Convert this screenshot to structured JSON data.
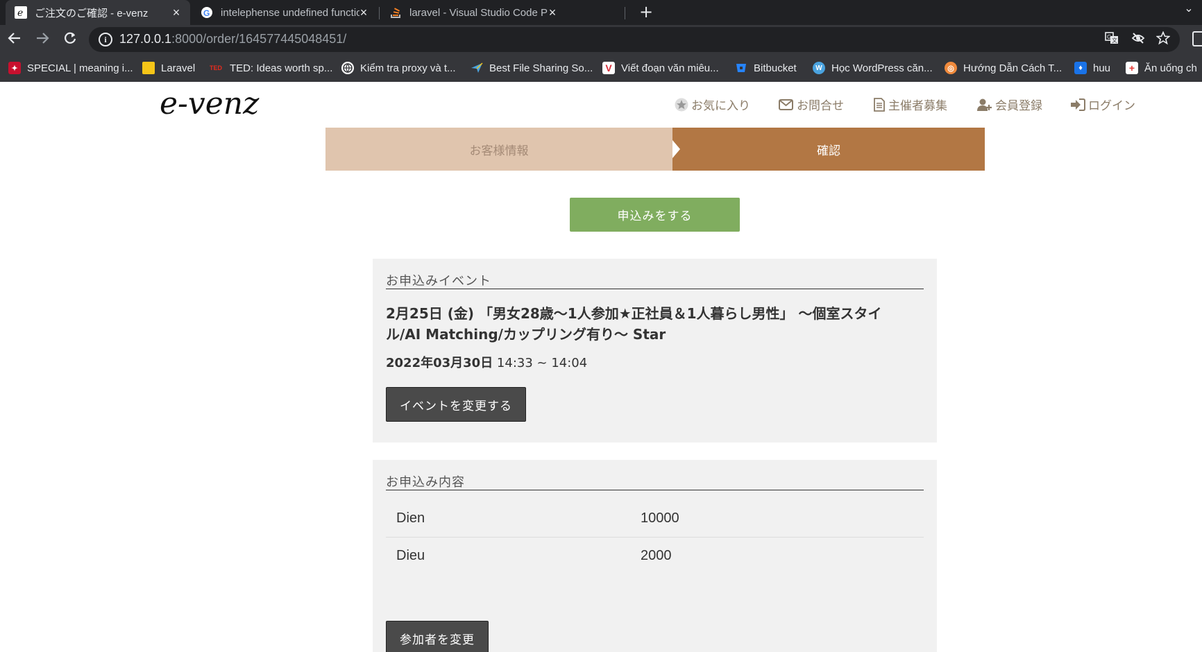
{
  "browser": {
    "tabs": [
      {
        "title": "ご注文のご確認 - e-venz",
        "icon": "e-icon",
        "active": true
      },
      {
        "title": "intelephense undefined function",
        "icon": "google-icon",
        "active": false
      },
      {
        "title": "laravel - Visual Studio Code PHP",
        "icon": "stackoverflow-icon",
        "active": false
      }
    ],
    "url": {
      "host": "127.0.0.1",
      "rest": ":8000/order/164577445048451/"
    },
    "bookmarks": [
      {
        "label": "SPECIAL | meaning i...",
        "icon": "cambridge-icon",
        "color": "#c8102e"
      },
      {
        "label": "Laravel",
        "icon": "folder-icon",
        "color": "#f5c518"
      },
      {
        "label": "TED: Ideas worth sp...",
        "icon": "ted-icon",
        "color": "#e62b1e"
      },
      {
        "label": "Kiểm tra proxy và t...",
        "icon": "globe-icon",
        "color": "#ffffff"
      },
      {
        "label": "Best File Sharing So...",
        "icon": "paper-plane-icon",
        "color": "#4aa3df"
      },
      {
        "label": "Viết đoạn văn miêu...",
        "icon": "v-icon",
        "color": "#d62d3a"
      },
      {
        "label": "Bitbucket",
        "icon": "bitbucket-icon",
        "color": "#2684ff"
      },
      {
        "label": "Học WordPress căn...",
        "icon": "wordpress-icon",
        "color": "#21759b"
      },
      {
        "label": "Hướng Dẫn Cách T...",
        "icon": "guide-icon",
        "color": "#f08a3c"
      },
      {
        "label": "huu",
        "icon": "huu-icon",
        "color": "#1a73e8"
      },
      {
        "label": "Ăn uống ch",
        "icon": "health-icon",
        "color": "#e53935"
      }
    ]
  },
  "site": {
    "logo": "e-venz",
    "nav": [
      {
        "label": "お気に入り",
        "icon": "star-icon"
      },
      {
        "label": "お問合せ",
        "icon": "envelope-icon"
      },
      {
        "label": "主催者募集",
        "icon": "document-icon"
      },
      {
        "label": "会員登録",
        "icon": "user-plus-icon"
      },
      {
        "label": "ログイン",
        "icon": "sign-in-icon"
      }
    ]
  },
  "steps": {
    "step1": "お客様情報",
    "step2": "確認"
  },
  "submit_label": "申込みをする",
  "event_card": {
    "heading": "お申込みイベント",
    "title": "2月25日 (金) 「男女28歳〜1人参加★正社員＆1人暮らし男性」 〜個室スタイル/AI Matching/カップリング有り〜 Star",
    "date": "2022年03月30日",
    "time": " 14:33 ~ 14:04",
    "change_button": "イベントを変更する"
  },
  "order_card": {
    "heading": "お申込み内容",
    "items": [
      {
        "name": "Dien",
        "value": "10000"
      },
      {
        "name": "Dieu",
        "value": "2000"
      }
    ],
    "change_button": "参加者を変更"
  },
  "colors": {
    "step_inactive": "#e0c5ae",
    "step_active": "#b27744",
    "submit": "#80ad5f",
    "dark_button": "#4a4a4a",
    "card_bg": "#f1f1f1",
    "nav_text": "#8b7c68"
  }
}
